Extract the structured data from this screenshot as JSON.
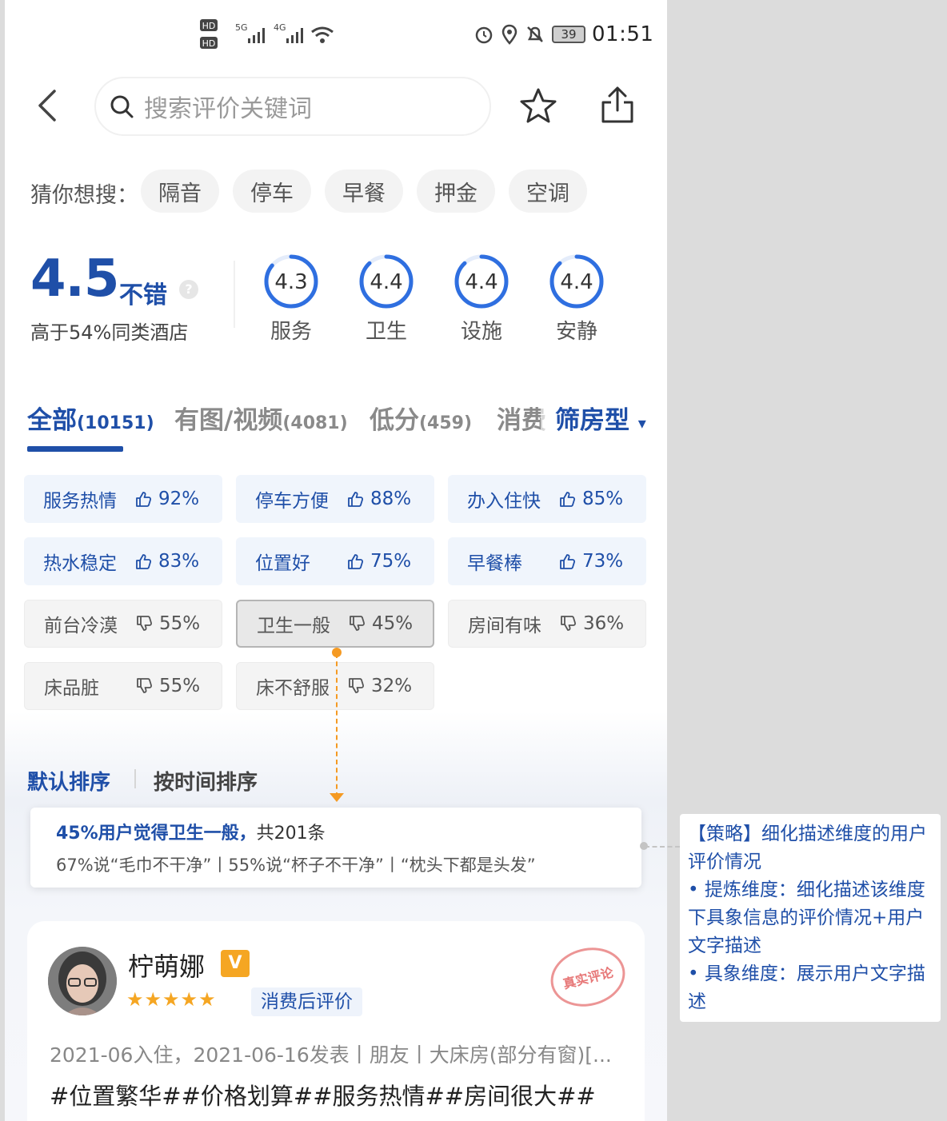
{
  "status_bar": {
    "net_hd1": "HD",
    "net_hd2": "HD",
    "net_5g": "5G",
    "net_4g": "4G",
    "battery": "39",
    "time": "01:51"
  },
  "search": {
    "placeholder": "搜索评价关键词"
  },
  "guess": {
    "label": "猜你想搜：",
    "chips": [
      "隔音",
      "停车",
      "早餐",
      "押金",
      "空调"
    ]
  },
  "rating": {
    "score": "4.5",
    "score_label": "不错",
    "help": "?",
    "compare": "高于54%同类酒店",
    "sub_scores": [
      {
        "value": "4.3",
        "label": "服务",
        "fraction": 0.86
      },
      {
        "value": "4.4",
        "label": "卫生",
        "fraction": 0.88
      },
      {
        "value": "4.4",
        "label": "设施",
        "fraction": 0.88
      },
      {
        "value": "4.4",
        "label": "安静",
        "fraction": 0.88
      }
    ]
  },
  "tabs": [
    {
      "label": "全部",
      "count": "(10151)",
      "active": true
    },
    {
      "label": "有图/视频",
      "count": "(4081)",
      "active": false
    },
    {
      "label": "低分",
      "count": "(459)",
      "active": false
    },
    {
      "label": "消费",
      "count": "",
      "active": false
    }
  ],
  "filter": {
    "label": "筛房型",
    "arrow": "▾"
  },
  "tags": [
    {
      "name": "服务热情",
      "pct": "92%",
      "kind": "positive"
    },
    {
      "name": "停车方便",
      "pct": "88%",
      "kind": "positive"
    },
    {
      "name": "办入住快",
      "pct": "85%",
      "kind": "positive"
    },
    {
      "name": "热水稳定",
      "pct": "83%",
      "kind": "positive"
    },
    {
      "name": "位置好",
      "pct": "75%",
      "kind": "positive"
    },
    {
      "name": "早餐棒",
      "pct": "73%",
      "kind": "positive"
    },
    {
      "name": "前台冷漠",
      "pct": "55%",
      "kind": "negative"
    },
    {
      "name": "卫生一般",
      "pct": "45%",
      "kind": "negative-selected"
    },
    {
      "name": "房间有味",
      "pct": "36%",
      "kind": "negative"
    },
    {
      "name": "床品脏",
      "pct": "55%",
      "kind": "negative"
    },
    {
      "name": "床不舒服",
      "pct": "32%",
      "kind": "negative"
    }
  ],
  "sort": {
    "default_label": "默认排序",
    "time_label": "按时间排序"
  },
  "summary": {
    "headline_blue": "45%用户觉得卫生一般，",
    "headline_rest": "共201条",
    "detail": "67%说“毛巾不干净”丨55%说“杯子不干净”丨“枕头下都是头发”"
  },
  "review": {
    "name": "柠萌娜",
    "level_badge": "V",
    "stars": "★★★★★",
    "rating_value": 5,
    "badge": "消费后评价",
    "stamp": "真实评论",
    "meta": "2021-06入住，2021-06-16发表丨朋友丨大床房(部分有窗)[...",
    "tags": "#位置繁华##价格划算##服务热情##房间很大##"
  },
  "note": {
    "title": "【策略】细化描述维度的用户评价情况",
    "bullet1": "• 提炼维度：细化描述该维度下具象信息的评价情况+用户文字描述",
    "bullet2": "• 具象维度：展示用户文字描述"
  },
  "colors": {
    "brand_blue": "#1f4fa8",
    "ring_blue": "#2f6fe0",
    "accent_orange": "#f59a23",
    "star_gold": "#f5a623"
  }
}
